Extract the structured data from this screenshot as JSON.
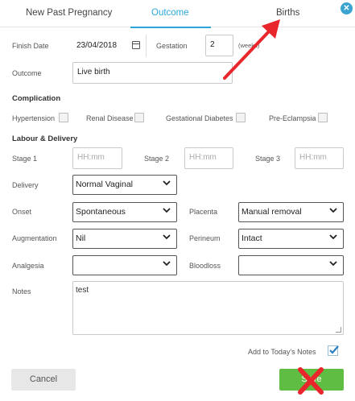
{
  "tabs": {
    "new_past_pregnancy": "New Past Pregnancy",
    "outcome": "Outcome",
    "births": "Births"
  },
  "colors": {
    "accent": "#2aa7d8",
    "save": "#5fbd44",
    "annotation": "#e8262c"
  },
  "form": {
    "finish_date_label": "Finish Date",
    "finish_date_value": "23/04/2018",
    "gestation_label": "Gestation",
    "gestation_value": "2",
    "weeks_label": "(weeks)",
    "outcome_label": "Outcome",
    "outcome_value": "Live birth"
  },
  "complication": {
    "heading": "Complication",
    "hypertension": "Hypertension",
    "renal_disease": "Renal Disease",
    "gestational_diabetes": "Gestational Diabetes",
    "pre_eclampsia": "Pre-Eclampsia"
  },
  "labour": {
    "heading": "Labour & Delivery",
    "stage1_label": "Stage 1",
    "stage2_label": "Stage 2",
    "stage3_label": "Stage 3",
    "time_placeholder": "HH:mm",
    "delivery_label": "Delivery",
    "delivery_value": "Normal Vaginal",
    "onset_label": "Onset",
    "onset_value": "Spontaneous",
    "placenta_label": "Placenta",
    "placenta_value": "Manual removal",
    "augmentation_label": "Augmentation",
    "augmentation_value": "Nil",
    "perineum_label": "Perineum",
    "perineum_value": "Intact",
    "analgesia_label": "Analgesia",
    "analgesia_value": "",
    "bloodloss_label": "Bloodloss",
    "bloodloss_value": ""
  },
  "notes": {
    "label": "Notes",
    "value": "test"
  },
  "footer": {
    "add_to_notes_label": "Add to Today's Notes",
    "cancel_label": "Cancel",
    "save_label": "Save"
  },
  "icons": {
    "close": "close-icon",
    "calendar": "calendar-icon",
    "chevron": "chevron-down-icon",
    "check": "checkmark-icon"
  }
}
